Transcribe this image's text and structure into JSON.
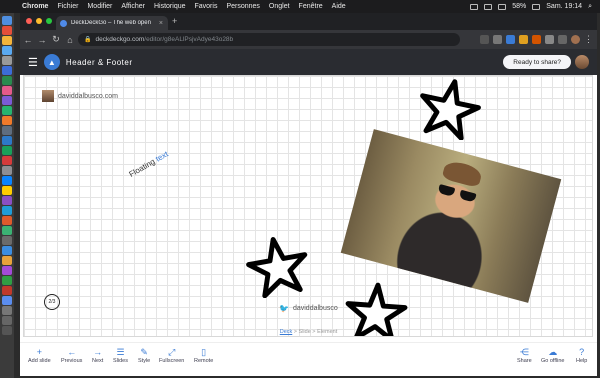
{
  "menubar": {
    "apple": "",
    "app": "Chrome",
    "items": [
      "Fichier",
      "Modifier",
      "Afficher",
      "Historique",
      "Favoris",
      "Personnes",
      "Onglet",
      "Fenêtre",
      "Aide"
    ],
    "battery": "58%",
    "clock": "Sam. 19:14"
  },
  "browser": {
    "tab_title": "DeckDeckGo – The web open",
    "tab_close": "×",
    "new_tab": "+",
    "url_host": "deckdeckgo.com",
    "url_path": "/editor/g8eALlPsjvAdye43o28b",
    "back": "←",
    "forward": "→",
    "reload": "↻",
    "home": "⌂"
  },
  "app": {
    "menu_icon": "☰",
    "doc_title": "Header & Footer",
    "share_label": "Ready to share?"
  },
  "slide": {
    "author": "daviddalbusco.com",
    "floating_text": "Floating",
    "floating_accent": "text",
    "slide_number": "2/3",
    "twitter_handle": "daviddalbusco"
  },
  "breadcrumb": {
    "deck": "Deck",
    "sep1": " > ",
    "slide": "Slide",
    "sep2": " > ",
    "element": "Element"
  },
  "actions": {
    "add_slide": {
      "icon": "+",
      "label": "Add slide"
    },
    "previous": {
      "icon": "←",
      "label": "Previous"
    },
    "next": {
      "icon": "→",
      "label": "Next"
    },
    "slides": {
      "icon": "☰",
      "label": "Slides"
    },
    "style": {
      "icon": "✎",
      "label": "Style"
    },
    "fullscreen": {
      "icon": "⤢",
      "label": "Fullscreen"
    },
    "remote": {
      "icon": "▯",
      "label": "Remote"
    },
    "share": {
      "icon": "⋲",
      "label": "Share"
    },
    "go_offline": {
      "icon": "☁",
      "label": "Go offline"
    },
    "help": {
      "icon": "?",
      "label": "Help"
    }
  },
  "colors": {
    "accent": "#3a7bd5",
    "header_bg": "#2a2c31",
    "tab_strip": "#202124"
  }
}
